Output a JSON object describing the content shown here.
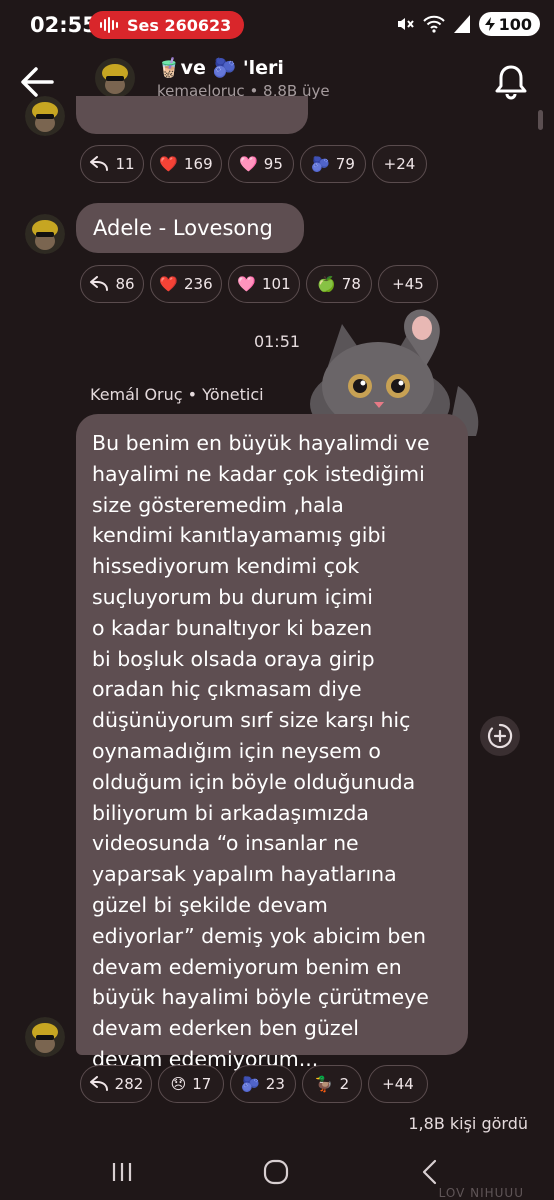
{
  "status_bar": {
    "time": "02:55",
    "recording_label": "Ses 260623",
    "battery": "100",
    "icons": [
      "mute-icon",
      "wifi-icon",
      "signal-icon",
      "battery-icon"
    ]
  },
  "header": {
    "title": "🧋ve 🫐 'leri",
    "subtitle": "kemaeloruc • 8,8B üye"
  },
  "messages": [
    {
      "id": "m0",
      "text": "",
      "reactions": [
        {
          "emoji": "↩",
          "count": "11"
        },
        {
          "emoji": "❤️",
          "count": "169"
        },
        {
          "emoji": "🩷",
          "count": "95"
        },
        {
          "emoji": "🫐",
          "count": "79"
        },
        {
          "emoji": "",
          "count": "+24"
        }
      ]
    },
    {
      "id": "m1",
      "text": "Adele - Lovesong",
      "reactions": [
        {
          "emoji": "↩",
          "count": "86"
        },
        {
          "emoji": "❤️",
          "count": "236"
        },
        {
          "emoji": "🩷",
          "count": "101"
        },
        {
          "emoji": "🍏",
          "count": "78"
        },
        {
          "emoji": "",
          "count": "+45"
        }
      ]
    },
    {
      "id": "m2",
      "timestamp": "01:51",
      "sender": "Kemál Oruç • Yönetici",
      "text": "Bu benim en büyük hayalimdi ve\nhayalimi ne kadar çok istediğimi\nsize gösteremedim ,hala\nkendimi kanıtlayamamış gibi\nhissediyorum kendimi çok\nsuçluyorum  bu durum içimi\no kadar bunaltıyor ki bazen\nbi boşluk olsada oraya girip\noradan hiç çıkmasam diye\ndüşünüyorum sırf size karşı  hiç\noynamadığım için neysem  o\nolduğum için böyle olduğunuda\nbiliyorum bi arkadaşımızda\nvideosunda “o insanlar ne\nyaparsak yapalım hayatlarına\ngüzel bi şekilde devam\nediyorlar” demiş yok abicim ben\ndevam edemiyorum benim en\nbüyük hayalimi böyle çürütmeye\ndevam ederken ben güzel\ndevam edemiyorum...",
      "reactions": [
        {
          "emoji": "↩",
          "count": "282"
        },
        {
          "emoji": "😞",
          "count": "17"
        },
        {
          "emoji": "🫐",
          "count": "23"
        },
        {
          "emoji": "🦆",
          "count": "2"
        },
        {
          "emoji": "",
          "count": "+44"
        }
      ]
    }
  ],
  "seen_label": "1,8B kişi gördü",
  "bottom_peek": "LOV NIHUUU"
}
